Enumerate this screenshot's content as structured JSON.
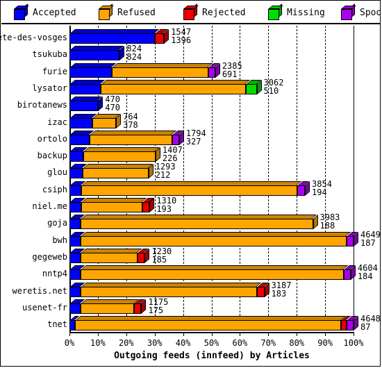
{
  "legend": {
    "items": [
      {
        "label": "Accepted",
        "color": "#0000ff",
        "icon": "cube-icon"
      },
      {
        "label": "Refused",
        "color": "#ffa500",
        "icon": "cube-icon"
      },
      {
        "label": "Rejected",
        "color": "#ee0000",
        "icon": "cube-icon"
      },
      {
        "label": "Missing",
        "color": "#00dd00",
        "icon": "cube-icon"
      },
      {
        "label": "Spooled",
        "color": "#aa00ee",
        "icon": "cube-icon"
      }
    ]
  },
  "chart_data": {
    "type": "bar",
    "orientation": "horizontal",
    "stacked": true,
    "title": "",
    "xlabel": "Outgoing feeds (innfeed) by Articles",
    "ylabel": "",
    "xlim": [
      0,
      100
    ],
    "xticks": [
      "0%",
      "10%",
      "20%",
      "30%",
      "40%",
      "50%",
      "60%",
      "70%",
      "80%",
      "90%",
      "100%"
    ],
    "grid": true,
    "legend_position": "top",
    "series_names": [
      "Accepted",
      "Refused",
      "Rejected",
      "Missing",
      "Spooled"
    ],
    "categories": [
      "bete-des-vosges",
      "tsukuba",
      "furie",
      "lysator",
      "birotanews",
      "izac",
      "ortolo",
      "backup",
      "glou",
      "csiph",
      "niel.me",
      "goja",
      "bwh",
      "gegeweb",
      "nntp4",
      "weretis.net",
      "usenet-fr",
      "tnet"
    ],
    "rows": [
      {
        "name": "bete-des-vosges",
        "total": 1547,
        "sub": 1396,
        "pct": 33.3,
        "segments": [
          {
            "series": "Accepted",
            "pct": 30.0
          },
          {
            "series": "Rejected",
            "pct": 3.3
          }
        ]
      },
      {
        "name": "tsukuba",
        "total": 824,
        "sub": 824,
        "pct": 17.7,
        "segments": [
          {
            "series": "Accepted",
            "pct": 17.7
          }
        ]
      },
      {
        "name": "furie",
        "total": 2385,
        "sub": 691,
        "pct": 51.3,
        "segments": [
          {
            "series": "Accepted",
            "pct": 14.9
          },
          {
            "series": "Refused",
            "pct": 34.0
          },
          {
            "series": "Spooled",
            "pct": 2.4
          }
        ]
      },
      {
        "name": "lysator",
        "total": 3062,
        "sub": 510,
        "pct": 65.9,
        "segments": [
          {
            "series": "Accepted",
            "pct": 11.0
          },
          {
            "series": "Refused",
            "pct": 51.0
          },
          {
            "series": "Missing",
            "pct": 3.9
          }
        ]
      },
      {
        "name": "birotanews",
        "total": 470,
        "sub": 470,
        "pct": 10.1,
        "segments": [
          {
            "series": "Accepted",
            "pct": 10.1
          }
        ]
      },
      {
        "name": "izac",
        "total": 764,
        "sub": 378,
        "pct": 16.4,
        "segments": [
          {
            "series": "Accepted",
            "pct": 8.1
          },
          {
            "series": "Refused",
            "pct": 8.3
          }
        ]
      },
      {
        "name": "ortolo",
        "total": 1794,
        "sub": 327,
        "pct": 38.6,
        "segments": [
          {
            "series": "Accepted",
            "pct": 7.0
          },
          {
            "series": "Refused",
            "pct": 29.2
          },
          {
            "series": "Spooled",
            "pct": 2.4
          }
        ]
      },
      {
        "name": "backup",
        "total": 1407,
        "sub": 226,
        "pct": 30.3,
        "segments": [
          {
            "series": "Accepted",
            "pct": 4.9
          },
          {
            "series": "Refused",
            "pct": 25.4
          }
        ]
      },
      {
        "name": "glou",
        "total": 1293,
        "sub": 212,
        "pct": 27.8,
        "segments": [
          {
            "series": "Accepted",
            "pct": 4.6
          },
          {
            "series": "Refused",
            "pct": 23.2
          }
        ]
      },
      {
        "name": "csiph",
        "total": 3854,
        "sub": 194,
        "pct": 82.9,
        "segments": [
          {
            "series": "Accepted",
            "pct": 4.2
          },
          {
            "series": "Refused",
            "pct": 76.0
          },
          {
            "series": "Spooled",
            "pct": 2.7
          }
        ]
      },
      {
        "name": "niel.me",
        "total": 1310,
        "sub": 193,
        "pct": 28.2,
        "segments": [
          {
            "series": "Accepted",
            "pct": 4.1
          },
          {
            "series": "Refused",
            "pct": 21.5
          },
          {
            "series": "Rejected",
            "pct": 2.6
          }
        ]
      },
      {
        "name": "goja",
        "total": 3983,
        "sub": 188,
        "pct": 85.7,
        "segments": [
          {
            "series": "Accepted",
            "pct": 4.0
          },
          {
            "series": "Refused",
            "pct": 81.7
          }
        ]
      },
      {
        "name": "bwh",
        "total": 4649,
        "sub": 187,
        "pct": 100.0,
        "segments": [
          {
            "series": "Accepted",
            "pct": 4.0
          },
          {
            "series": "Refused",
            "pct": 93.6
          },
          {
            "series": "Spooled",
            "pct": 2.4
          }
        ]
      },
      {
        "name": "gegeweb",
        "total": 1230,
        "sub": 185,
        "pct": 26.5,
        "segments": [
          {
            "series": "Accepted",
            "pct": 4.0
          },
          {
            "series": "Refused",
            "pct": 20.0
          },
          {
            "series": "Rejected",
            "pct": 2.5
          }
        ]
      },
      {
        "name": "nntp4",
        "total": 4604,
        "sub": 184,
        "pct": 99.0,
        "segments": [
          {
            "series": "Accepted",
            "pct": 4.0
          },
          {
            "series": "Refused",
            "pct": 92.6
          },
          {
            "series": "Spooled",
            "pct": 2.4
          }
        ]
      },
      {
        "name": "weretis.net",
        "total": 3187,
        "sub": 183,
        "pct": 68.6,
        "segments": [
          {
            "series": "Accepted",
            "pct": 3.9
          },
          {
            "series": "Refused",
            "pct": 62.1
          },
          {
            "series": "Rejected",
            "pct": 2.6
          }
        ]
      },
      {
        "name": "usenet-fr",
        "total": 1175,
        "sub": 175,
        "pct": 25.3,
        "segments": [
          {
            "series": "Accepted",
            "pct": 3.8
          },
          {
            "series": "Refused",
            "pct": 19.0
          },
          {
            "series": "Rejected",
            "pct": 2.5
          }
        ]
      },
      {
        "name": "tnet",
        "total": 4648,
        "sub": 87,
        "pct": 100.0,
        "segments": [
          {
            "series": "Accepted",
            "pct": 1.9
          },
          {
            "series": "Refused",
            "pct": 93.8
          },
          {
            "series": "Rejected",
            "pct": 1.9
          },
          {
            "series": "Spooled",
            "pct": 2.4
          }
        ]
      }
    ]
  }
}
